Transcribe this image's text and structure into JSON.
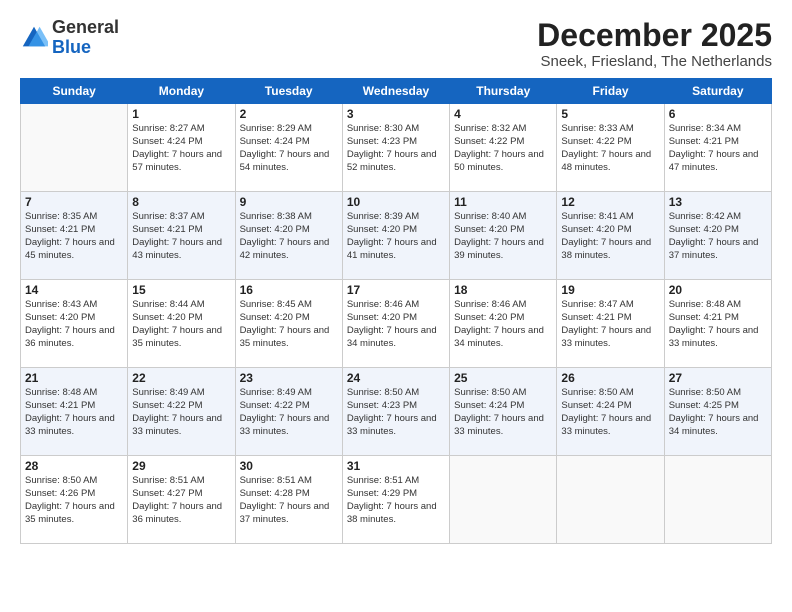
{
  "logo": {
    "general": "General",
    "blue": "Blue"
  },
  "title": "December 2025",
  "location": "Sneek, Friesland, The Netherlands",
  "days": [
    "Sunday",
    "Monday",
    "Tuesday",
    "Wednesday",
    "Thursday",
    "Friday",
    "Saturday"
  ],
  "weeks": [
    [
      {
        "day": "",
        "sunrise": "",
        "sunset": "",
        "daylight": ""
      },
      {
        "day": "1",
        "sunrise": "Sunrise: 8:27 AM",
        "sunset": "Sunset: 4:24 PM",
        "daylight": "Daylight: 7 hours and 57 minutes."
      },
      {
        "day": "2",
        "sunrise": "Sunrise: 8:29 AM",
        "sunset": "Sunset: 4:24 PM",
        "daylight": "Daylight: 7 hours and 54 minutes."
      },
      {
        "day": "3",
        "sunrise": "Sunrise: 8:30 AM",
        "sunset": "Sunset: 4:23 PM",
        "daylight": "Daylight: 7 hours and 52 minutes."
      },
      {
        "day": "4",
        "sunrise": "Sunrise: 8:32 AM",
        "sunset": "Sunset: 4:22 PM",
        "daylight": "Daylight: 7 hours and 50 minutes."
      },
      {
        "day": "5",
        "sunrise": "Sunrise: 8:33 AM",
        "sunset": "Sunset: 4:22 PM",
        "daylight": "Daylight: 7 hours and 48 minutes."
      },
      {
        "day": "6",
        "sunrise": "Sunrise: 8:34 AM",
        "sunset": "Sunset: 4:21 PM",
        "daylight": "Daylight: 7 hours and 47 minutes."
      }
    ],
    [
      {
        "day": "7",
        "sunrise": "Sunrise: 8:35 AM",
        "sunset": "Sunset: 4:21 PM",
        "daylight": "Daylight: 7 hours and 45 minutes."
      },
      {
        "day": "8",
        "sunrise": "Sunrise: 8:37 AM",
        "sunset": "Sunset: 4:21 PM",
        "daylight": "Daylight: 7 hours and 43 minutes."
      },
      {
        "day": "9",
        "sunrise": "Sunrise: 8:38 AM",
        "sunset": "Sunset: 4:20 PM",
        "daylight": "Daylight: 7 hours and 42 minutes."
      },
      {
        "day": "10",
        "sunrise": "Sunrise: 8:39 AM",
        "sunset": "Sunset: 4:20 PM",
        "daylight": "Daylight: 7 hours and 41 minutes."
      },
      {
        "day": "11",
        "sunrise": "Sunrise: 8:40 AM",
        "sunset": "Sunset: 4:20 PM",
        "daylight": "Daylight: 7 hours and 39 minutes."
      },
      {
        "day": "12",
        "sunrise": "Sunrise: 8:41 AM",
        "sunset": "Sunset: 4:20 PM",
        "daylight": "Daylight: 7 hours and 38 minutes."
      },
      {
        "day": "13",
        "sunrise": "Sunrise: 8:42 AM",
        "sunset": "Sunset: 4:20 PM",
        "daylight": "Daylight: 7 hours and 37 minutes."
      }
    ],
    [
      {
        "day": "14",
        "sunrise": "Sunrise: 8:43 AM",
        "sunset": "Sunset: 4:20 PM",
        "daylight": "Daylight: 7 hours and 36 minutes."
      },
      {
        "day": "15",
        "sunrise": "Sunrise: 8:44 AM",
        "sunset": "Sunset: 4:20 PM",
        "daylight": "Daylight: 7 hours and 35 minutes."
      },
      {
        "day": "16",
        "sunrise": "Sunrise: 8:45 AM",
        "sunset": "Sunset: 4:20 PM",
        "daylight": "Daylight: 7 hours and 35 minutes."
      },
      {
        "day": "17",
        "sunrise": "Sunrise: 8:46 AM",
        "sunset": "Sunset: 4:20 PM",
        "daylight": "Daylight: 7 hours and 34 minutes."
      },
      {
        "day": "18",
        "sunrise": "Sunrise: 8:46 AM",
        "sunset": "Sunset: 4:20 PM",
        "daylight": "Daylight: 7 hours and 34 minutes."
      },
      {
        "day": "19",
        "sunrise": "Sunrise: 8:47 AM",
        "sunset": "Sunset: 4:21 PM",
        "daylight": "Daylight: 7 hours and 33 minutes."
      },
      {
        "day": "20",
        "sunrise": "Sunrise: 8:48 AM",
        "sunset": "Sunset: 4:21 PM",
        "daylight": "Daylight: 7 hours and 33 minutes."
      }
    ],
    [
      {
        "day": "21",
        "sunrise": "Sunrise: 8:48 AM",
        "sunset": "Sunset: 4:21 PM",
        "daylight": "Daylight: 7 hours and 33 minutes."
      },
      {
        "day": "22",
        "sunrise": "Sunrise: 8:49 AM",
        "sunset": "Sunset: 4:22 PM",
        "daylight": "Daylight: 7 hours and 33 minutes."
      },
      {
        "day": "23",
        "sunrise": "Sunrise: 8:49 AM",
        "sunset": "Sunset: 4:22 PM",
        "daylight": "Daylight: 7 hours and 33 minutes."
      },
      {
        "day": "24",
        "sunrise": "Sunrise: 8:50 AM",
        "sunset": "Sunset: 4:23 PM",
        "daylight": "Daylight: 7 hours and 33 minutes."
      },
      {
        "day": "25",
        "sunrise": "Sunrise: 8:50 AM",
        "sunset": "Sunset: 4:24 PM",
        "daylight": "Daylight: 7 hours and 33 minutes."
      },
      {
        "day": "26",
        "sunrise": "Sunrise: 8:50 AM",
        "sunset": "Sunset: 4:24 PM",
        "daylight": "Daylight: 7 hours and 33 minutes."
      },
      {
        "day": "27",
        "sunrise": "Sunrise: 8:50 AM",
        "sunset": "Sunset: 4:25 PM",
        "daylight": "Daylight: 7 hours and 34 minutes."
      }
    ],
    [
      {
        "day": "28",
        "sunrise": "Sunrise: 8:50 AM",
        "sunset": "Sunset: 4:26 PM",
        "daylight": "Daylight: 7 hours and 35 minutes."
      },
      {
        "day": "29",
        "sunrise": "Sunrise: 8:51 AM",
        "sunset": "Sunset: 4:27 PM",
        "daylight": "Daylight: 7 hours and 36 minutes."
      },
      {
        "day": "30",
        "sunrise": "Sunrise: 8:51 AM",
        "sunset": "Sunset: 4:28 PM",
        "daylight": "Daylight: 7 hours and 37 minutes."
      },
      {
        "day": "31",
        "sunrise": "Sunrise: 8:51 AM",
        "sunset": "Sunset: 4:29 PM",
        "daylight": "Daylight: 7 hours and 38 minutes."
      },
      {
        "day": "",
        "sunrise": "",
        "sunset": "",
        "daylight": ""
      },
      {
        "day": "",
        "sunrise": "",
        "sunset": "",
        "daylight": ""
      },
      {
        "day": "",
        "sunrise": "",
        "sunset": "",
        "daylight": ""
      }
    ]
  ]
}
